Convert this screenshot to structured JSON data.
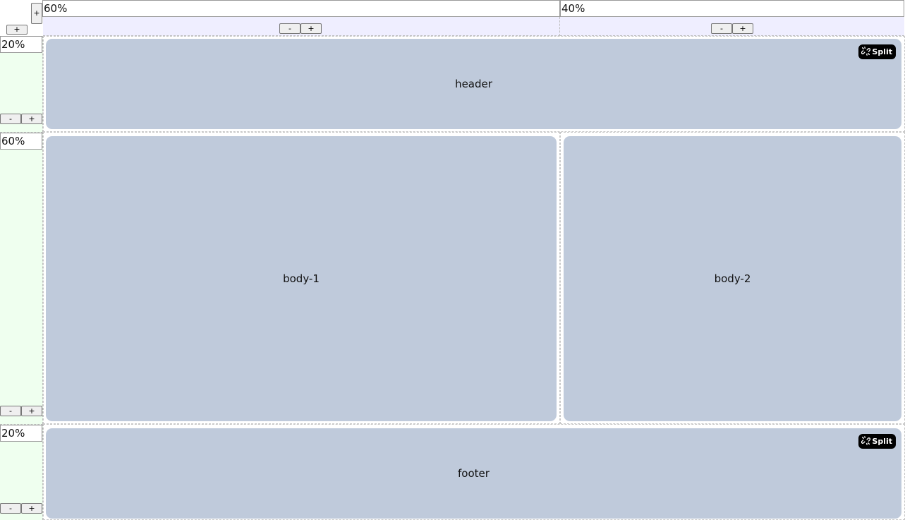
{
  "columns": [
    {
      "value": "60%",
      "minus": "-",
      "plus": "+"
    },
    {
      "value": "40%",
      "minus": "-",
      "plus": "+"
    }
  ],
  "rows": [
    {
      "value": "20%",
      "minus": "-",
      "plus": "+"
    },
    {
      "value": "60%",
      "minus": "-",
      "plus": "+"
    },
    {
      "value": "20%",
      "minus": "-",
      "plus": "+"
    }
  ],
  "corner": {
    "add_column": "+",
    "add_row": "+"
  },
  "panels": {
    "header": "header",
    "body_1": "body-1",
    "body_2": "body-2",
    "footer": "footer"
  },
  "split_label": "Split",
  "colors": {
    "panel": "#bfcadb",
    "column_band": "#efeeff",
    "row_band": "#efffef",
    "split_button": "#000000"
  }
}
